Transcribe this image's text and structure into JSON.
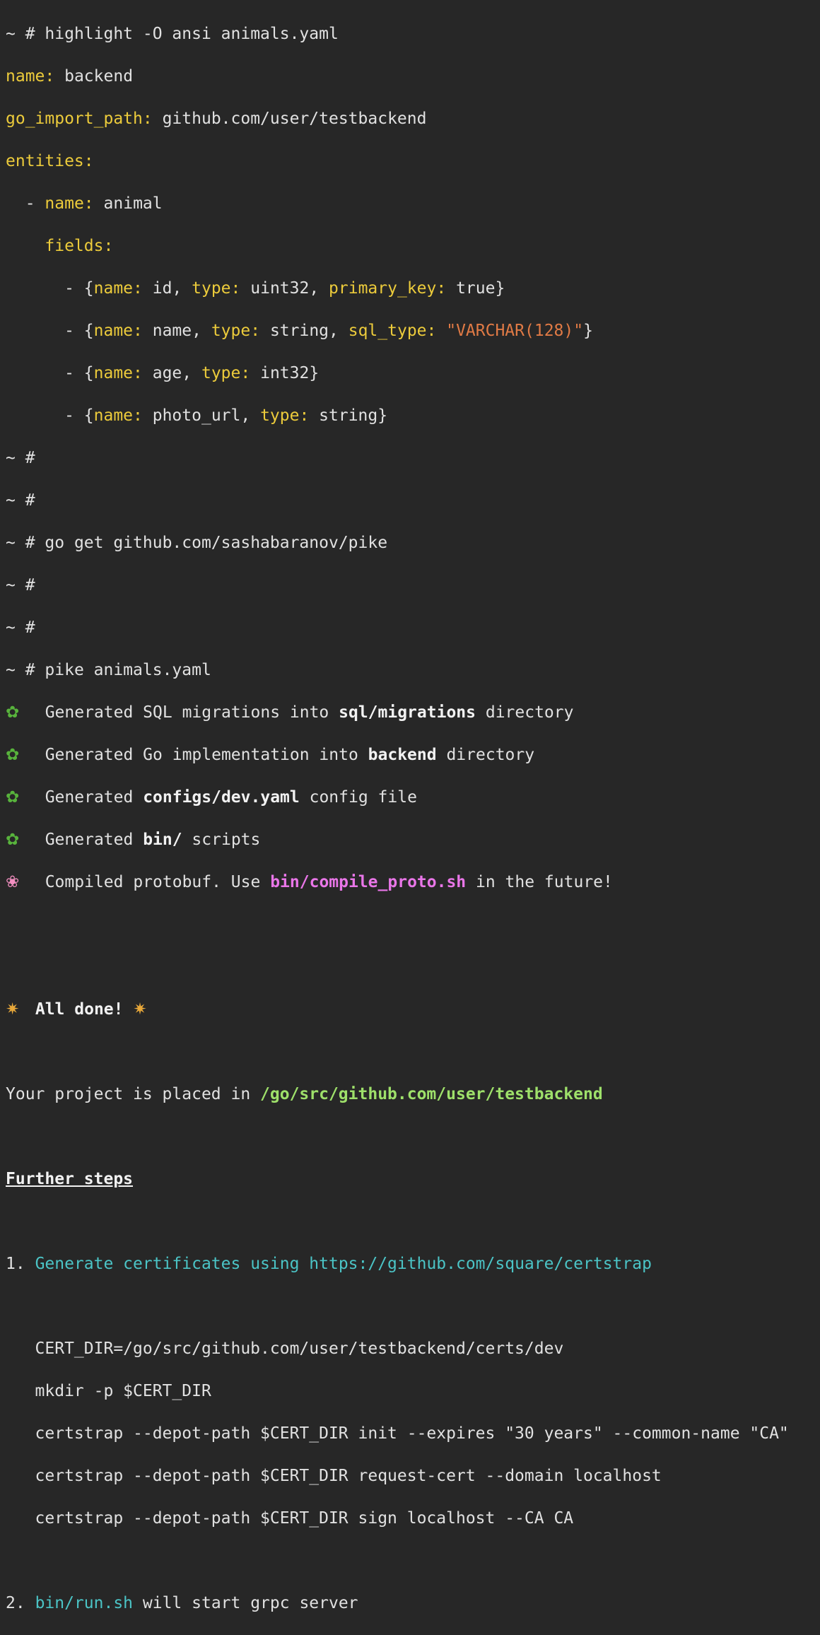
{
  "terminal": {
    "prompt": "~ #",
    "cmd_highlight": "highlight -O ansi animals.yaml",
    "yaml": {
      "name_key": "name:",
      "name_val": "backend",
      "go_import_key": "go_import_path:",
      "go_import_val": "github.com/user/testbackend",
      "entities_key": "entities:",
      "entity_dash": "-",
      "entity_name_key": "name:",
      "entity_name_val": "animal",
      "fields_key": "fields:",
      "fields": [
        {
          "name_key": "name:",
          "name_val": "id",
          "type_key": "type:",
          "type_val": "uint32",
          "extra_key": "primary_key:",
          "extra_val": "true"
        },
        {
          "name_key": "name:",
          "name_val": "name",
          "type_key": "type:",
          "type_val": "string",
          "extra_key": "sql_type:",
          "extra_val": "\"VARCHAR(128)\""
        },
        {
          "name_key": "name:",
          "name_val": "age",
          "type_key": "type:",
          "type_val": "int32"
        },
        {
          "name_key": "name:",
          "name_val": "photo_url",
          "type_key": "type:",
          "type_val": "string"
        }
      ]
    },
    "cmd_goget": "go get github.com/sashabaranov/pike",
    "cmd_pike": "pike animals.yaml",
    "output": {
      "leaf_icon": "herb-icon",
      "flower_icon": "cherry-blossom-icon",
      "party_icon": "party-popper-icon",
      "line1_a": "Generated SQL migrations into ",
      "line1_b": "sql/migrations",
      "line1_c": " directory",
      "line2_a": "Generated Go implementation into ",
      "line2_b": "backend",
      "line2_c": " directory",
      "line3_a": "Generated ",
      "line3_b": "configs/dev.yaml",
      "line3_c": " config file",
      "line4_a": "Generated ",
      "line4_b": "bin/",
      "line4_c": " scripts",
      "line5_a": "Compiled protobuf. Use ",
      "line5_b": "bin/compile_proto.sh",
      "line5_c": " in the future!",
      "all_done": "All done!",
      "project_a": "Your project is placed in ",
      "project_b": "/go/src/github.com/user/testbackend",
      "further_steps": "Further steps",
      "step1_num": "1.",
      "step1_text": "Generate certificates using https://github.com/square/certstrap",
      "cert_cmds": [
        "CERT_DIR=/go/src/github.com/user/testbackend/certs/dev",
        "mkdir -p $CERT_DIR",
        "certstrap --depot-path $CERT_DIR init --expires \"30 years\" --common-name \"CA\"",
        "certstrap --depot-path $CERT_DIR request-cert --domain localhost",
        "certstrap --depot-path $CERT_DIR sign localhost --CA CA"
      ],
      "step2_num": "2.",
      "step2_a": "bin/run.sh",
      "step2_b": " will start grpc server"
    }
  },
  "colors": {
    "background": "#272727",
    "text": "#e1e1e1",
    "yaml_key": "#eccb3b",
    "yaml_string": "#e07a45",
    "pink": "#e976e8",
    "green": "#9ee06a",
    "cyan": "#4bc4c6"
  }
}
